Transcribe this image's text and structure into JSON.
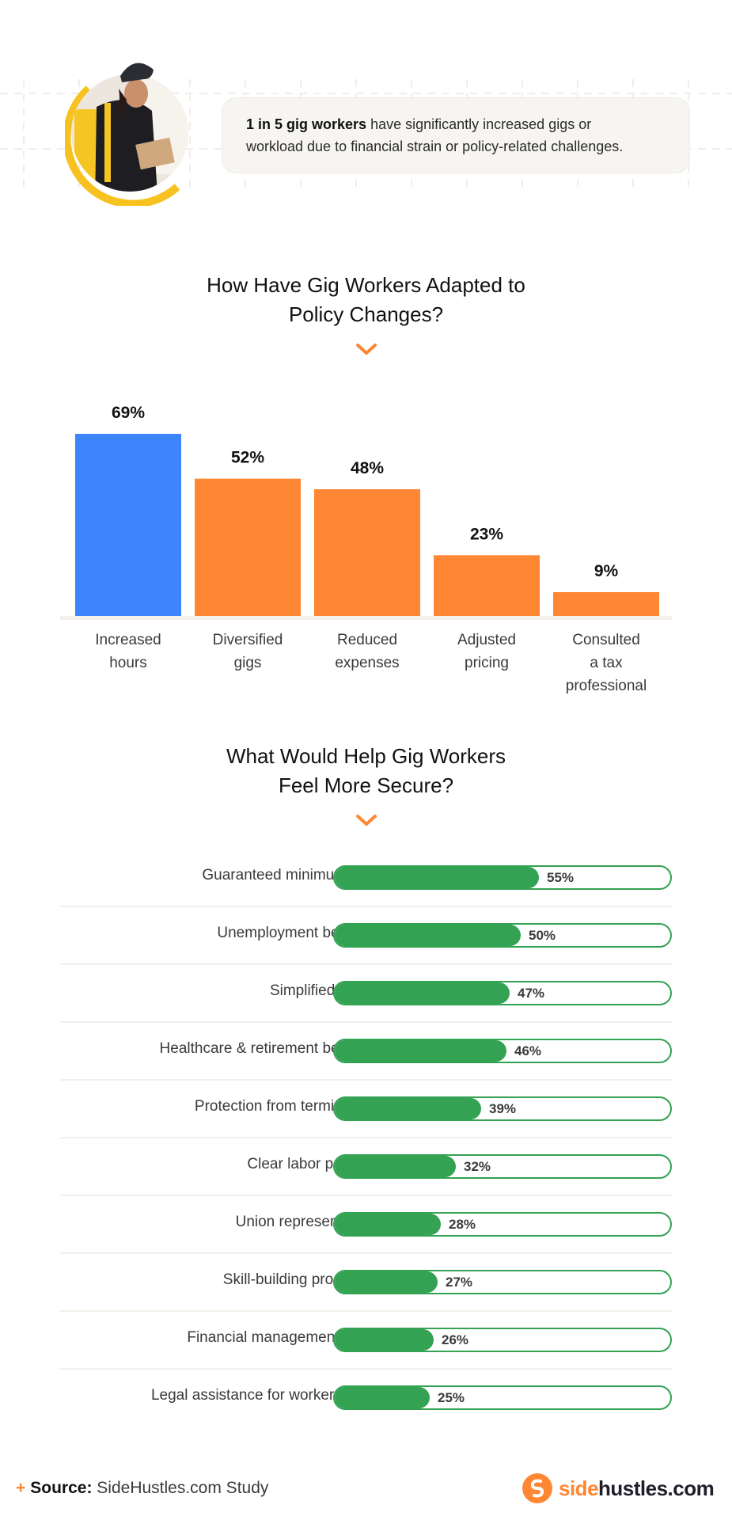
{
  "colors": {
    "accent_orange": "#ff8633",
    "highlight_blue": "#3d85fc",
    "progress_green": "#34a253",
    "callout_bg": "#f7f5f1",
    "avatar_ring": "#f7c21f"
  },
  "hero": {
    "image_alt": "Delivery worker in helmet holding a package and phone",
    "callout_bold": "1 in 5 gig workers",
    "callout_rest_line1": " have significantly increased gigs or",
    "callout_rest_line2": "workload due to financial strain or policy-related challenges."
  },
  "section1": {
    "title_line1": "How Have Gig Workers Adapted to",
    "title_line2": "Policy Changes?",
    "chevron_icon": "chevron-down-icon"
  },
  "section2": {
    "title_line1": "What Would Help Gig Workers",
    "title_line2": "Feel More Secure?",
    "chevron_icon": "chevron-down-icon"
  },
  "chart_data": [
    {
      "type": "bar",
      "title": "How Have Gig Workers Adapted to Policy Changes?",
      "xlabel": "",
      "ylabel": "",
      "ylim": [
        0,
        69
      ],
      "grid": false,
      "legend": "none",
      "categories": [
        [
          "Increased",
          "hours"
        ],
        [
          "Diversified",
          "gigs"
        ],
        [
          "Reduced",
          "expenses"
        ],
        [
          "Adjusted",
          "pricing"
        ],
        [
          "Consulted",
          "a tax",
          "professional"
        ]
      ],
      "values": [
        69,
        52,
        48,
        23,
        9
      ],
      "labels": [
        "69%",
        "52%",
        "48%",
        "23%",
        "9%"
      ],
      "highlight_index": 0,
      "unit": "%"
    },
    {
      "type": "bar",
      "orientation": "horizontal",
      "title": "What Would Help Gig Workers Feel More Secure?",
      "xlabel": "",
      "ylabel": "",
      "xlim": [
        0,
        100
      ],
      "grid": false,
      "legend": "none",
      "unit": "%",
      "items": [
        {
          "label": "Guaranteed minimum pay",
          "value": 55,
          "display": "55%"
        },
        {
          "label": "Unemployment benefits",
          "value": 50,
          "display": "50%"
        },
        {
          "label": "Simplified taxes",
          "value": 47,
          "display": "47%"
        },
        {
          "label": "Healthcare & retirement benefits",
          "value": 46,
          "display": "46%"
        },
        {
          "label": "Protection from termination",
          "value": 39,
          "display": "39%"
        },
        {
          "label": "Clear labor policies",
          "value": 32,
          "display": "32%"
        },
        {
          "label": "Union representation",
          "value": 28,
          "display": "28%"
        },
        {
          "label": "Skill-building programs",
          "value": 27,
          "display": "27%"
        },
        {
          "label": "Financial management tools",
          "value": 26,
          "display": "26%"
        },
        {
          "label": "Legal assistance for worker rights",
          "value": 25,
          "display": "25%"
        }
      ]
    }
  ],
  "footer": {
    "plus_icon": "+",
    "source_label": "Source:",
    "source_text": " SideHustles.com Study",
    "brand_accent": "side",
    "brand_main": "hustles.com",
    "brand_icon": "sidehustles-logo-icon"
  }
}
